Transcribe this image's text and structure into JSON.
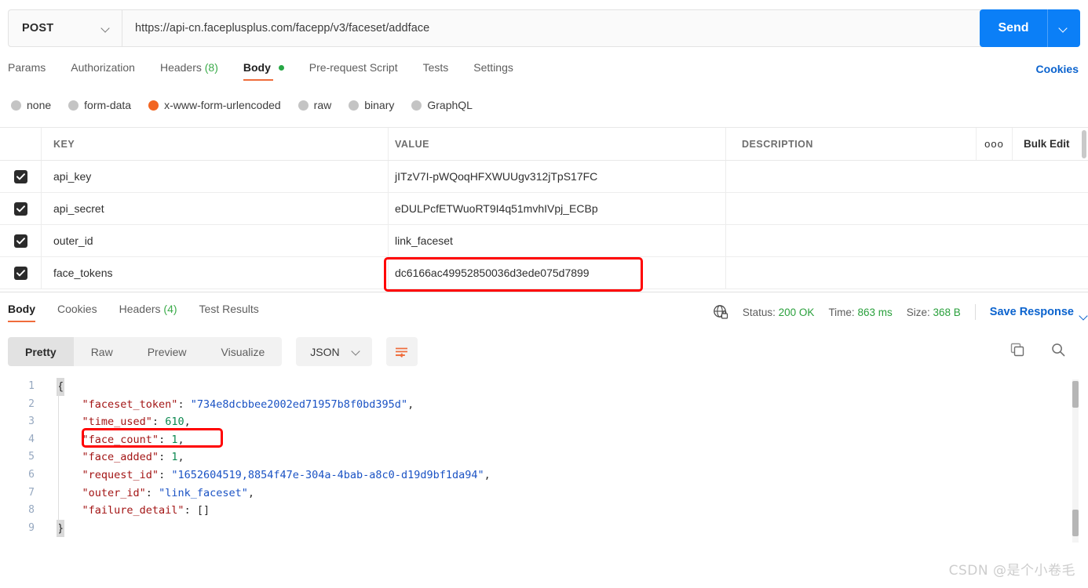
{
  "request": {
    "method": "POST",
    "url": "https://api-cn.faceplusplus.com/facepp/v3/faceset/addface",
    "send_label": "Send",
    "cookies_label": "Cookies",
    "tabs": [
      {
        "label": "Params",
        "active": false
      },
      {
        "label": "Authorization",
        "active": false
      },
      {
        "label": "Headers",
        "count": "(8)",
        "active": false
      },
      {
        "label": "Body",
        "active": true,
        "dot": true
      },
      {
        "label": "Pre-request Script",
        "active": false
      },
      {
        "label": "Tests",
        "active": false
      },
      {
        "label": "Settings",
        "active": false
      }
    ],
    "body_types": [
      {
        "label": "none",
        "selected": false
      },
      {
        "label": "form-data",
        "selected": false
      },
      {
        "label": "x-www-form-urlencoded",
        "selected": true
      },
      {
        "label": "raw",
        "selected": false
      },
      {
        "label": "binary",
        "selected": false
      },
      {
        "label": "GraphQL",
        "selected": false
      }
    ],
    "table": {
      "headers": {
        "key": "KEY",
        "value": "VALUE",
        "description": "DESCRIPTION",
        "bulk_edit": "Bulk Edit"
      },
      "rows": [
        {
          "checked": true,
          "key": "api_key",
          "value": "jITzV7I-pWQoqHFXWUUgv312jTpS17FC",
          "description": ""
        },
        {
          "checked": true,
          "key": "api_secret",
          "value": "eDULPcfETWuoRT9I4q51mvhIVpj_ECBp",
          "description": ""
        },
        {
          "checked": true,
          "key": "outer_id",
          "value": "link_faceset",
          "description": ""
        },
        {
          "checked": true,
          "key": "face_tokens",
          "value": "dc6166ac49952850036d3ede075d7899",
          "description": ""
        }
      ]
    }
  },
  "response": {
    "tabs": [
      {
        "label": "Body",
        "active": true
      },
      {
        "label": "Cookies",
        "active": false
      },
      {
        "label": "Headers",
        "count": "(4)",
        "active": false
      },
      {
        "label": "Test Results",
        "active": false
      }
    ],
    "status_label": "Status:",
    "status_value": "200 OK",
    "time_label": "Time:",
    "time_value": "863 ms",
    "size_label": "Size:",
    "size_value": "368 B",
    "save_response": "Save Response",
    "view_modes": [
      {
        "label": "Pretty",
        "active": true
      },
      {
        "label": "Raw",
        "active": false
      },
      {
        "label": "Preview",
        "active": false
      },
      {
        "label": "Visualize",
        "active": false
      }
    ],
    "format": "JSON",
    "json": {
      "faceset_token": "734e8dcbbee2002ed71957b8f0bd395d",
      "time_used": "610",
      "face_count": "1",
      "face_added": "1",
      "request_id": "1652604519,8854f47e-304a-4bab-a8c0-d19d9bf1da94",
      "outer_id": "link_faceset",
      "failure_detail": "[]"
    },
    "line_numbers": [
      "1",
      "2",
      "3",
      "4",
      "5",
      "6",
      "7",
      "8",
      "9"
    ]
  },
  "watermark": "CSDN @是个小卷毛",
  "colors": {
    "accent_orange": "#ef6c3b",
    "radio_orange": "#f26522",
    "send_blue": "#0b7ff7",
    "link_blue": "#0b63ce",
    "status_green": "#2aa03c",
    "annotation_red": "#ff0000"
  }
}
